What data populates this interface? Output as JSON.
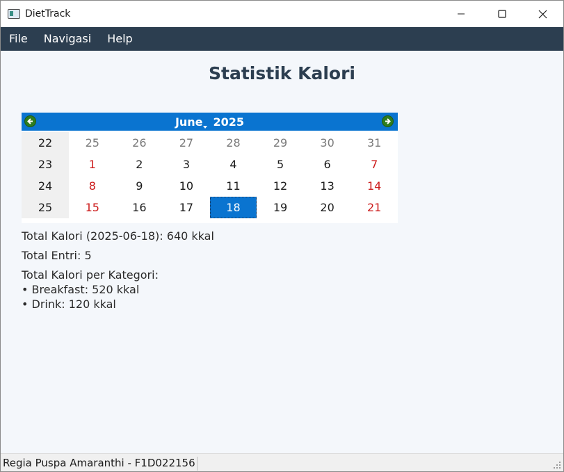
{
  "window": {
    "title": "DietTrack",
    "icon": "app-window-icon"
  },
  "menubar": {
    "items": [
      "File",
      "Navigasi",
      "Help"
    ]
  },
  "page": {
    "title": "Statistik Kalori"
  },
  "calendar": {
    "month": "June",
    "year": "2025",
    "selected": "18",
    "rows": [
      {
        "week": "22",
        "days": [
          "25",
          "26",
          "27",
          "28",
          "29",
          "30",
          "31"
        ]
      },
      {
        "week": "23",
        "days": [
          "1",
          "2",
          "3",
          "4",
          "5",
          "6",
          "7"
        ]
      },
      {
        "week": "24",
        "days": [
          "8",
          "9",
          "10",
          "11",
          "12",
          "13",
          "14"
        ]
      },
      {
        "week": "25",
        "days": [
          "15",
          "16",
          "17",
          "18",
          "19",
          "20",
          "21"
        ]
      }
    ],
    "colors": {
      "header": "#0a74d0",
      "weekend": "#cc1b1b",
      "other_month": "#7a7a7a",
      "selected_bg": "#0a74d0"
    }
  },
  "stats": {
    "total_kalori": "Total Kalori (2025-06-18): 640 kkal",
    "total_entri": "Total Entri: 5",
    "per_kategori_label": "Total Kalori per Kategori:",
    "kategori": [
      "• Breakfast: 520 kkal",
      "• Drink: 120 kkal"
    ]
  },
  "statusbar": {
    "text": "Regia Puspa Amaranthi - F1D022156"
  },
  "theme": {
    "menubar_bg": "#2c3e50",
    "title_color": "#2c3e50",
    "content_bg": "#f4f7fb"
  }
}
